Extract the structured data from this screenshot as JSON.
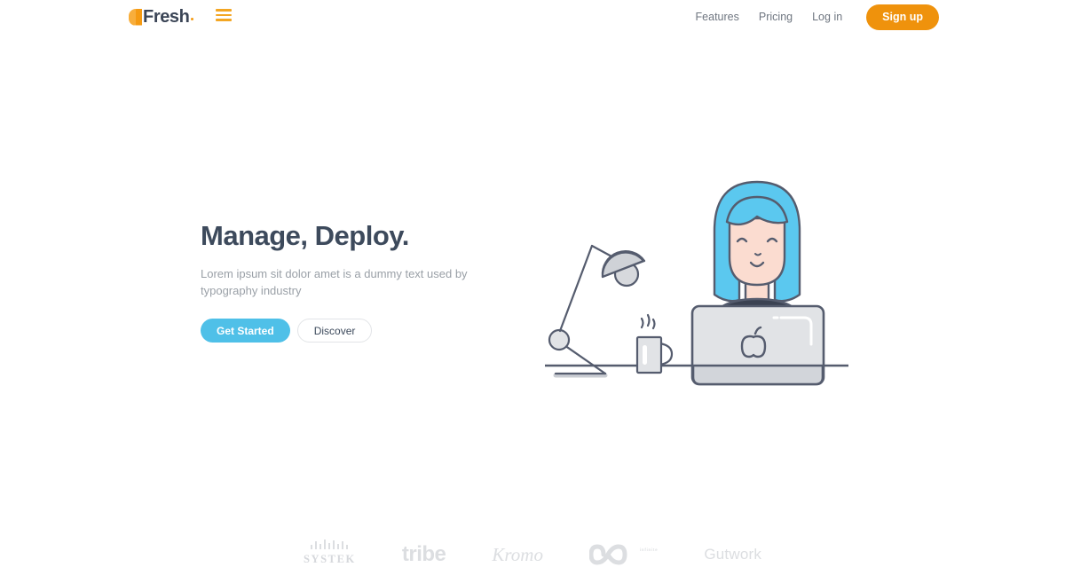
{
  "brand": {
    "name": "Fresh",
    "mark_icon": "fresh-half-circle-icon",
    "accent_color": "#f59a12"
  },
  "header": {
    "menu_icon": "hamburger-menu-icon",
    "nav_links": [
      {
        "label": "Features"
      },
      {
        "label": "Pricing"
      },
      {
        "label": "Log in"
      }
    ],
    "signup_label": "Sign up",
    "signup_color": "#ef920c"
  },
  "hero": {
    "title": "Manage, Deploy.",
    "subtitle": "Lorem ipsum sit dolor amet is a dummy text used by typography industry",
    "primary_button": "Get Started",
    "secondary_button": "Discover",
    "primary_color": "#4fc0e8",
    "title_color": "#3d4a5c"
  },
  "illustration": {
    "name": "woman-at-laptop-illustration",
    "hair_color": "#5bc8ef",
    "skin_color": "#fbdcd0",
    "shirt_color": "#3b4252",
    "laptop_color": "#e1e3e6",
    "outline_color": "#555c6e",
    "items": [
      {
        "name": "desk-lamp"
      },
      {
        "name": "coffee-mug"
      },
      {
        "name": "laptop"
      },
      {
        "name": "person"
      }
    ]
  },
  "clients": {
    "logos": [
      {
        "name": "systek",
        "label": "SYSTEK",
        "bars": [
          5,
          9,
          6,
          11,
          7,
          10,
          6,
          9,
          5
        ]
      },
      {
        "name": "tribe",
        "label": "tribe"
      },
      {
        "name": "kromo",
        "label": "Kromo"
      },
      {
        "name": "infinite",
        "label": "infinite",
        "icon": "infinity-icon"
      },
      {
        "name": "gutwork",
        "label": "Gutwork"
      }
    ],
    "color": "#dcdee1"
  }
}
